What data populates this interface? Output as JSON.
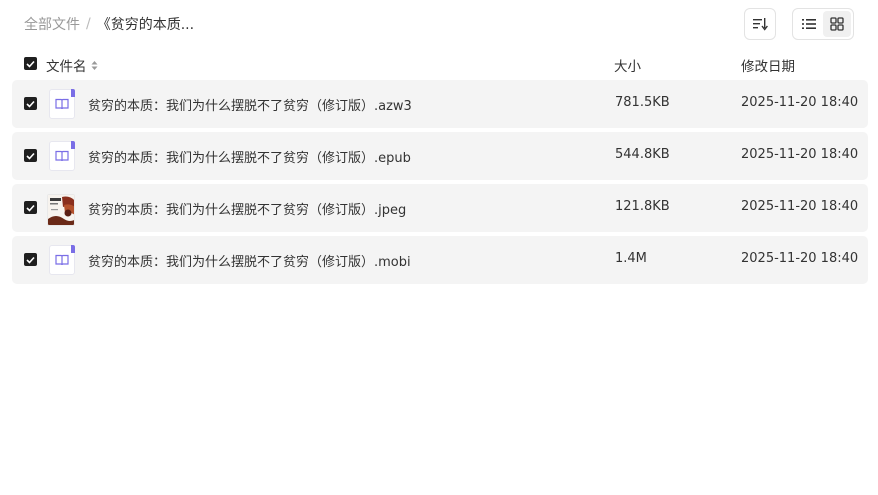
{
  "breadcrumb": {
    "root": "全部文件",
    "separator": "/",
    "current": "《贫穷的本质..."
  },
  "toolbar": {
    "sort_icon": "sort-descending-icon",
    "views": [
      {
        "icon": "list-view-icon",
        "active": true
      },
      {
        "icon": "grid-view-icon",
        "active": false
      }
    ]
  },
  "table": {
    "columns": {
      "name": "文件名",
      "size": "大小",
      "date": "修改日期"
    },
    "rows": [
      {
        "name": "贫穷的本质：我们为什么摆脱不了贫穷（修订版）.azw3",
        "size": "781.5KB",
        "date": "2025-11-20 18:40",
        "icon": "ebook-file-icon",
        "checked": true
      },
      {
        "name": "贫穷的本质：我们为什么摆脱不了贫穷（修订版）.epub",
        "size": "544.8KB",
        "date": "2025-11-20 18:40",
        "icon": "ebook-file-icon",
        "checked": true
      },
      {
        "name": "贫穷的本质：我们为什么摆脱不了贫穷（修订版）.jpeg",
        "size": "121.8KB",
        "date": "2025-11-20 18:40",
        "icon": "image-thumbnail",
        "checked": true
      },
      {
        "name": "贫穷的本质：我们为什么摆脱不了贫穷（修订版）.mobi",
        "size": "1.4M",
        "date": "2025-11-20 18:40",
        "icon": "ebook-file-icon",
        "checked": true
      }
    ]
  },
  "colors": {
    "row_background": "#f4f4f4",
    "ebook_icon_accent": "#7a6ee6",
    "checkbox": "#1f1f1f"
  }
}
